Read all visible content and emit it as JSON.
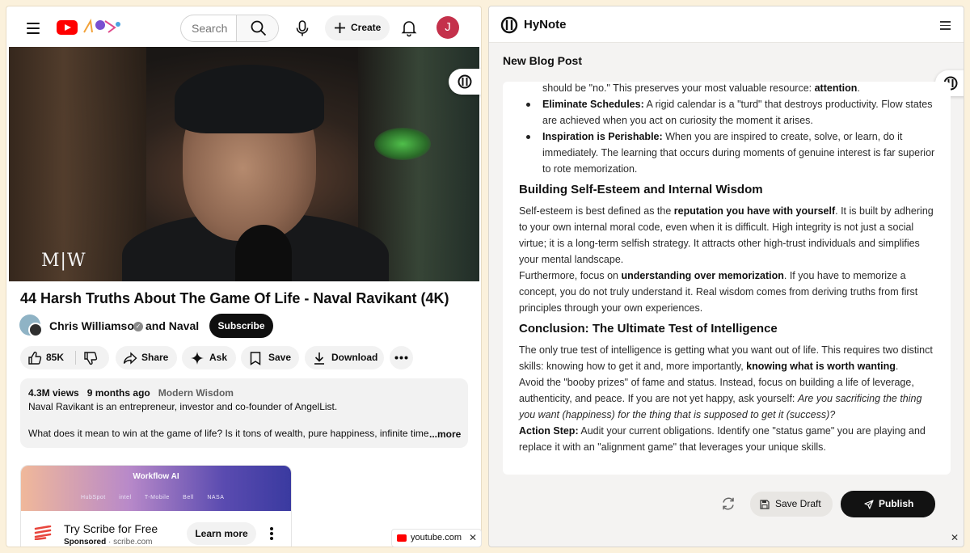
{
  "youtube": {
    "search_placeholder": "Search",
    "create_label": "Create",
    "avatar_letter": "J",
    "video": {
      "overlay_logo": "M|W",
      "title": "44 Harsh Truths About The Game Of Life - Naval Ravikant (4K)"
    },
    "channel": {
      "name": "Chris Williamson",
      "collab": "and Naval",
      "subscribe_label": "Subscribe"
    },
    "actions": {
      "likes": "85K",
      "share": "Share",
      "ask": "Ask",
      "save": "Save",
      "download": "Download"
    },
    "description": {
      "views": "4.3M views",
      "age": "9 months ago",
      "tag": "Modern Wisdom",
      "line1": "Naval Ravikant is an entrepreneur, investor and co-founder of AngelList.",
      "line2": "What does it mean to win at the game of life? Is it tons of wealth, pure happiness, infinite time, or",
      "more": "...more"
    },
    "ad": {
      "banner_title": "Workflow AI",
      "logos": [
        "HubSpot",
        "intel",
        "T-Mobile",
        "Bell",
        "NASA"
      ],
      "title": "Try Scribe for Free",
      "sponsored": "Sponsored",
      "domain": "· scribe.com",
      "cta": "Learn more"
    },
    "tab": {
      "label": "youtube.com",
      "close": "✕"
    }
  },
  "hynote": {
    "brand": "HyNote",
    "doc_title": "New Blog Post",
    "content": {
      "p0": "should be \"no.\" This preserves your most valuable resource: ",
      "p0_b": "attention",
      "p0_end": ".",
      "b1_head": "Eliminate Schedules:",
      "b1_text": " A rigid calendar is a \"turd\" that destroys productivity. Flow states are achieved when you act on curiosity the moment it arises.",
      "b2_head": "Inspiration is Perishable:",
      "b2_text": " When you are inspired to create, solve, or learn, do it immediately. The learning that occurs during moments of genuine interest is far superior to rote memorization.",
      "h1": "Building Self-Esteem and Internal Wisdom",
      "s1a": "Self-esteem is best defined as the ",
      "s1b": "reputation you have with yourself",
      "s1c": ". It is built by adhering to your own internal moral code, even when it is difficult. High integrity is not just a social virtue; it is a long-term selfish strategy. It attracts other high-trust individuals and simplifies your mental landscape.",
      "s2a": "Furthermore, focus on ",
      "s2b": "understanding over memorization",
      "s2c": ". If you have to memorize a concept, you do not truly understand it. Real wisdom comes from deriving truths from first principles through your own experiences.",
      "h2": "Conclusion: The Ultimate Test of Intelligence",
      "c1a": "The only true test of intelligence is getting what you want out of life. This requires two distinct skills: knowing how to get it and, more importantly, ",
      "c1b": "knowing what is worth wanting",
      "c1c": ".",
      "c2a": "Avoid the \"booby prizes\" of fame and status. Instead, focus on building a life of leverage, authenticity, and peace. If you are not yet happy, ask yourself: ",
      "c2i": "Are you sacrificing the thing you want (happiness) for the thing that is supposed to get it (success)?",
      "c3b": "Action Step:",
      "c3t": " Audit your current obligations. Identify one \"status game\" you are playing and replace it with an \"alignment game\" that leverages your unique skills."
    },
    "save_draft": "Save Draft",
    "publish": "Publish",
    "close": "✕"
  },
  "colors": {
    "youtube_red": "#ff0000",
    "publish_bg": "#121212",
    "avatar_bg": "#c4314b"
  }
}
